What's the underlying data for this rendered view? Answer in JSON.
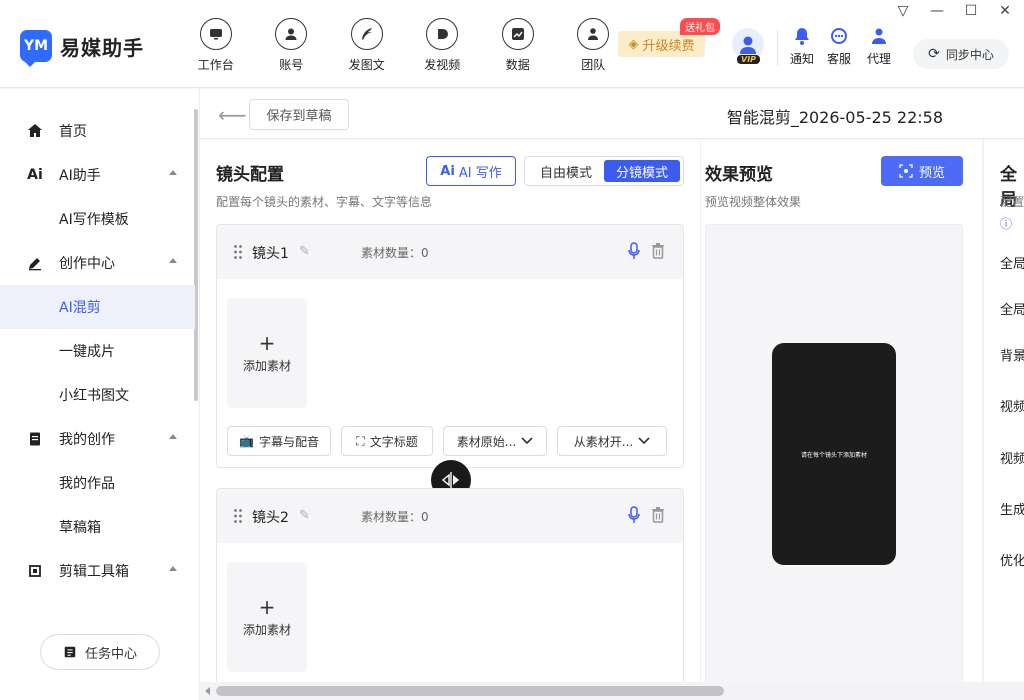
{
  "window": {
    "minimize": "—",
    "maximize": "☐",
    "close": "✕",
    "pin": "▽"
  },
  "app": {
    "name": "易媒助手",
    "logo_text": "YM",
    "brand_color": "#2f6bff"
  },
  "nav": [
    {
      "label": "工作台"
    },
    {
      "label": "账号"
    },
    {
      "label": "发图文"
    },
    {
      "label": "发视频"
    },
    {
      "label": "数据"
    },
    {
      "label": "团队"
    }
  ],
  "upgrade": {
    "label": "升级续费",
    "badge": "送礼包"
  },
  "vip": {
    "tag": "VIP"
  },
  "tools": {
    "notify": "通知",
    "service": "客服",
    "agent": "代理"
  },
  "sync": {
    "label": "同步中心"
  },
  "sidebar": {
    "items": [
      {
        "label": "首页"
      },
      {
        "label": "AI助手"
      },
      {
        "label": "AI写作模板"
      },
      {
        "label": "创作中心"
      },
      {
        "label": "AI混剪"
      },
      {
        "label": "一键成片"
      },
      {
        "label": "小红书图文"
      },
      {
        "label": "我的创作"
      },
      {
        "label": "我的作品"
      },
      {
        "label": "草稿箱"
      },
      {
        "label": "剪辑工具箱"
      }
    ],
    "task_center": "任务中心"
  },
  "header": {
    "save_draft": "保存到草稿",
    "project_title": "智能混剪_2026-05-25 22:58"
  },
  "shots": {
    "title": "镜头配置",
    "desc": "配置每个镜头的素材、字幕、文字等信息",
    "ai_write": "AI 写作",
    "mode_free": "自由模式",
    "mode_split": "分镜模式",
    "cards": [
      {
        "name": "镜头1",
        "count": "素材数量：0",
        "add": "添加素材",
        "tools": [
          "字幕与配音",
          "文字标题",
          "素材原始...",
          "从素材开..."
        ]
      },
      {
        "name": "镜头2",
        "count": "素材数量：0",
        "add": "添加素材"
      }
    ]
  },
  "preview": {
    "title": "效果预览",
    "desc": "预览视频整体效果",
    "button": "预览",
    "placeholder": "请在每个镜头下添加素材"
  },
  "global": {
    "title": "全局",
    "desc": "配置",
    "items": [
      "全局",
      "全局",
      "背景",
      "视频",
      "视频",
      "生成",
      "优化"
    ]
  }
}
